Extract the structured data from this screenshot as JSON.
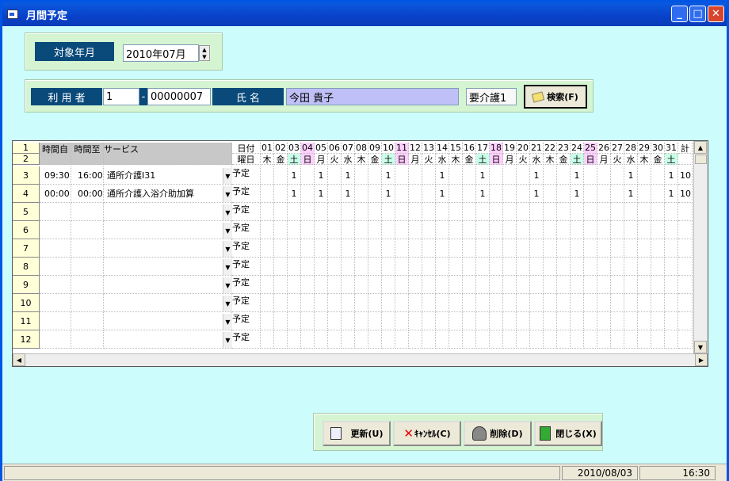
{
  "window": {
    "title": "月間予定"
  },
  "target": {
    "label": "対象年月",
    "value": "2010年07月"
  },
  "user": {
    "label": "利 用 者",
    "code1": "1",
    "dash": "-",
    "code2": "00000007",
    "name_label": "氏 名",
    "name": "今田 貴子",
    "care": "要介護1",
    "search_button": "検索(F)"
  },
  "grid": {
    "row_numbers": [
      "1",
      "2",
      "3",
      "4",
      "5",
      "6",
      "7",
      "8",
      "9",
      "10",
      "11",
      "12"
    ],
    "col_time_from": "時間自",
    "col_time_to": "時間至",
    "col_service": "サービス",
    "date_label": "日付",
    "dow_label": "曜日",
    "total_label": "計",
    "days": [
      "01",
      "02",
      "03",
      "04",
      "05",
      "06",
      "07",
      "08",
      "09",
      "10",
      "11",
      "12",
      "13",
      "14",
      "15",
      "16",
      "17",
      "18",
      "19",
      "20",
      "21",
      "22",
      "23",
      "24",
      "25",
      "26",
      "27",
      "28",
      "29",
      "30",
      "31"
    ],
    "dows": [
      "木",
      "金",
      "土",
      "日",
      "月",
      "火",
      "水",
      "木",
      "金",
      "土",
      "日",
      "月",
      "火",
      "水",
      "木",
      "金",
      "土",
      "日",
      "月",
      "火",
      "水",
      "木",
      "金",
      "土",
      "日",
      "月",
      "火",
      "水",
      "木",
      "金",
      "土"
    ],
    "kind": "予定",
    "rows": [
      {
        "from": "09:30",
        "to": "16:00",
        "service": "通所介護Ⅰ31",
        "marks": [
          "3",
          "5",
          "7",
          "10",
          "14",
          "17",
          "21",
          "24",
          "28",
          "31"
        ],
        "mark": "1",
        "total": "10"
      },
      {
        "from": "00:00",
        "to": "00:00",
        "service": "通所介護入浴介助加算",
        "marks": [
          "3",
          "5",
          "7",
          "10",
          "14",
          "17",
          "21",
          "24",
          "28",
          "31"
        ],
        "mark": "1",
        "total": "10"
      }
    ]
  },
  "buttons": {
    "update": "更新(U)",
    "cancel": "ｷｬﾝｾﾙ(C)",
    "delete": "削除(D)",
    "close": "閉じる(X)"
  },
  "status": {
    "date": "2010/08/03",
    "time": "16:30"
  }
}
